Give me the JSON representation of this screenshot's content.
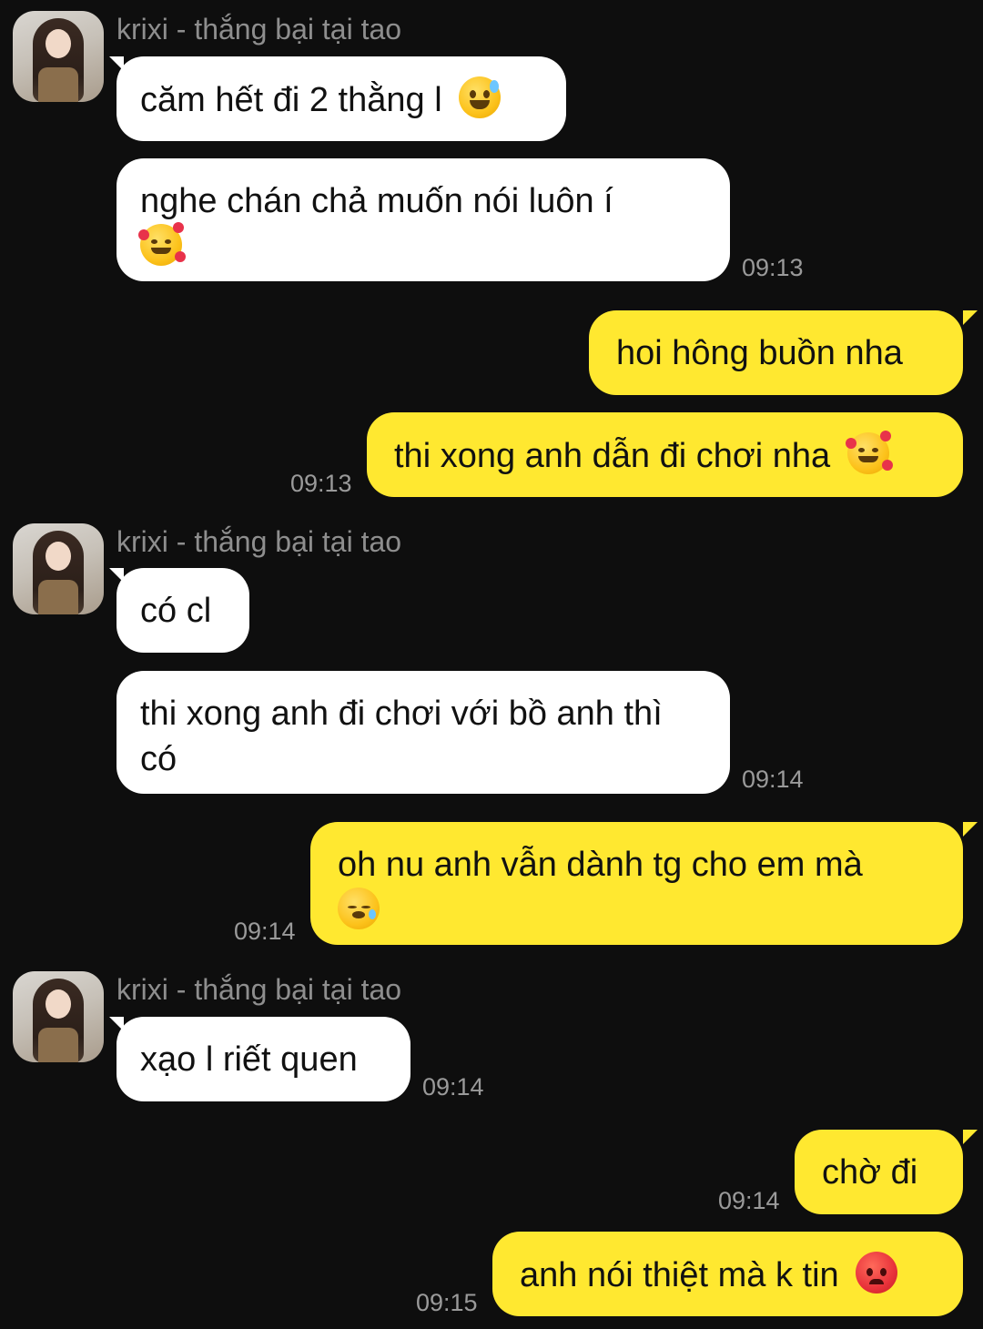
{
  "sender_name": "krixi - thắng bại tại tao",
  "groups": [
    {
      "sender": "krixi - thắng bại tại tao",
      "messages": [
        {
          "text": "căm hết đi 2 thằng l",
          "emoji": "grinning-sweat-emoji"
        },
        {
          "text": "nghe chán chả muốn nói luôn í",
          "emoji": "smiling-hearts-emoji",
          "time": "09:13"
        }
      ]
    },
    {
      "sender": "me",
      "messages": [
        {
          "text": "hoi hông buồn nha"
        },
        {
          "text": "thi xong anh dẫn đi chơi nha",
          "emoji": "smiling-hearts-emoji",
          "time": "09:13"
        }
      ]
    },
    {
      "sender": "krixi - thắng bại tại tao",
      "messages": [
        {
          "text": "có cl"
        },
        {
          "text": "thi xong anh đi chơi với bồ anh thì có",
          "time": "09:14"
        }
      ]
    },
    {
      "sender": "me",
      "messages": [
        {
          "text": "oh nu anh vẫn dành tg cho em mà",
          "emoji": "sleepy-emoji",
          "time": "09:14"
        }
      ]
    },
    {
      "sender": "krixi - thắng bại tại tao",
      "messages": [
        {
          "text": "xạo l riết quen",
          "time": "09:14"
        }
      ]
    },
    {
      "sender": "me",
      "messages": [
        {
          "text": "chờ đi",
          "time": "09:14"
        },
        {
          "text": "anh nói thiệt mà k tin",
          "emoji": "angry-face-emoji",
          "time": "09:15"
        }
      ]
    }
  ],
  "colors": {
    "background": "#0e0e0e",
    "incoming_bubble": "#ffffff",
    "outgoing_bubble": "#ffe830",
    "sender_name": "#8e8e8e",
    "timestamp": "#9a9a9a"
  }
}
